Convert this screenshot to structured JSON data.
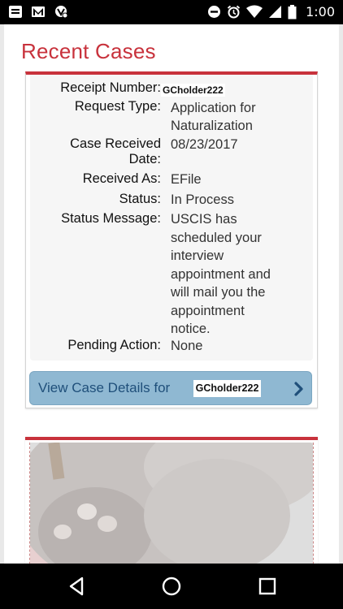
{
  "status_bar": {
    "time": "1:00",
    "left_icons": [
      "notes-icon",
      "gmail-icon",
      "app-badge-icon"
    ],
    "right_icons": [
      "do-not-disturb-icon",
      "alarm-icon",
      "wifi-icon",
      "signal-icon",
      "battery-icon"
    ]
  },
  "page": {
    "title": "Recent Cases"
  },
  "case": {
    "receipt_number_label": "Receipt Number:",
    "receipt_number": "GCholder222",
    "request_type_label": "Request Type:",
    "request_type_lines": [
      "Application for",
      "Naturalization"
    ],
    "received_date_label_lines": [
      "Case Received",
      "Date:"
    ],
    "received_date": "08/23/2017",
    "received_as_label": "Received As:",
    "received_as": "EFile",
    "status_label": "Status:",
    "status": "In Process",
    "status_message_label": "Status Message:",
    "status_message_lines": [
      "USCIS has",
      "scheduled your",
      "interview",
      "appointment and",
      "will mail you the",
      "appointment",
      "notice."
    ],
    "pending_action_label": "Pending Action:",
    "pending_action": "None",
    "details_button_label": "View Case Details for",
    "details_button_user": "GCholder222"
  },
  "colors": {
    "accent_red": "#c8323c",
    "button_blue": "#8fb8d2",
    "button_text": "#1f4f7a"
  },
  "nav_bar": {
    "icons": [
      "back-icon",
      "home-icon",
      "recents-icon"
    ]
  }
}
